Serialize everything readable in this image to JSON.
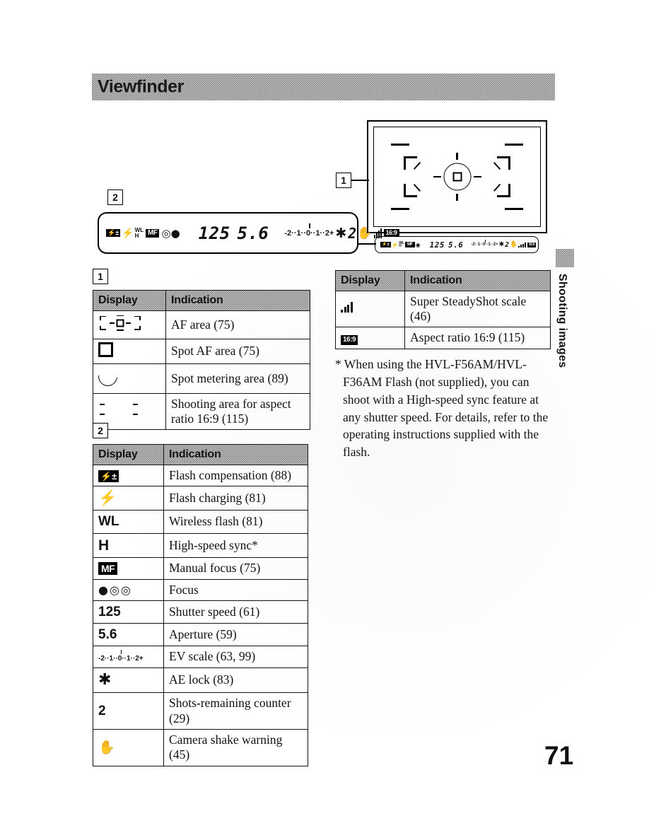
{
  "section": {
    "title": "Viewfinder"
  },
  "callouts": {
    "one": "1",
    "two": "2"
  },
  "lcd": {
    "flash_comp_icon": "flash-compensation-icon",
    "bolt": "⚡",
    "wl": "WL",
    "h": "H",
    "mf": "MF",
    "focus_dot": "●",
    "focus_ring": "◉",
    "focus_paren": "()",
    "shutter_speed": "125",
    "aperture": "5.6",
    "ev_scale": "-2··1··0··1··2+",
    "ae_lock": "✱",
    "shots_remaining": "2",
    "shake_icon": "camera-shake-icon",
    "steadyshot_icon": "steadyshot-bars-icon",
    "aspect_icon": "16:9"
  },
  "table1": {
    "marker": "1",
    "headers": [
      "Display",
      "Indication"
    ],
    "rows": [
      {
        "icon": "af-area-icon",
        "indication": "AF area (75)"
      },
      {
        "icon": "spot-af-area-icon",
        "indication": "Spot AF area (75)"
      },
      {
        "icon": "spot-metering-area-icon",
        "indication": "Spot metering area (89)"
      },
      {
        "icon": "aspect-169-area-icon",
        "indication": "Shooting area for aspect ratio 16:9 (115)"
      }
    ]
  },
  "table2": {
    "marker": "2",
    "headers": [
      "Display",
      "Indication"
    ],
    "rows": [
      {
        "icon": "flash-compensation-icon",
        "indication": "Flash compensation (88)"
      },
      {
        "icon": "flash-charging-icon",
        "indication": "Flash charging (81)"
      },
      {
        "icon": "wireless-flash-icon",
        "indication": "Wireless flash (81)"
      },
      {
        "icon": "high-speed-sync-icon",
        "indication": "High-speed sync*"
      },
      {
        "icon": "manual-focus-icon",
        "indication": "Manual focus (75)"
      },
      {
        "icon": "focus-indicator-icon",
        "indication": "Focus"
      },
      {
        "icon": "shutter-speed-value",
        "indication": "Shutter speed (61)"
      },
      {
        "icon": "aperture-value",
        "indication": "Aperture (59)"
      },
      {
        "icon": "ev-scale-icon",
        "indication": "EV scale (63, 99)"
      },
      {
        "icon": "ae-lock-icon",
        "indication": "AE lock (83)"
      },
      {
        "icon": "shots-remaining-value",
        "indication": "Shots-remaining counter (29)"
      },
      {
        "icon": "camera-shake-icon",
        "indication": "Camera shake warning (45)"
      }
    ],
    "labels": {
      "wl": "WL",
      "h": "H",
      "mf": "MF",
      "shutter_speed": "125",
      "aperture": "5.6",
      "shots_remaining": "2",
      "ev_scale": "-2··1··0··1··2+",
      "bolt": "⚡",
      "ae_lock": "✱",
      "focus_dot": "●",
      "focus_ring": "◉",
      "focus_paren": "()",
      "shake": "✋"
    }
  },
  "table3": {
    "headers": [
      "Display",
      "Indication"
    ],
    "rows": [
      {
        "icon": "steadyshot-bars-icon",
        "indication": "Super SteadyShot scale (46)"
      },
      {
        "icon": "aspect-ratio-169-icon",
        "indication": "Aspect ratio 16:9 (115)"
      }
    ],
    "labels": {
      "aspect": "16:9"
    }
  },
  "footnote": {
    "text": "* When using the HVL-F56AM/HVL-F36AM Flash (not supplied), you can shoot with a High-speed sync feature at any shutter speed. For details, refer to the operating instructions supplied with the flash."
  },
  "side_tab": {
    "label": "Shooting images"
  },
  "page_number": "71"
}
